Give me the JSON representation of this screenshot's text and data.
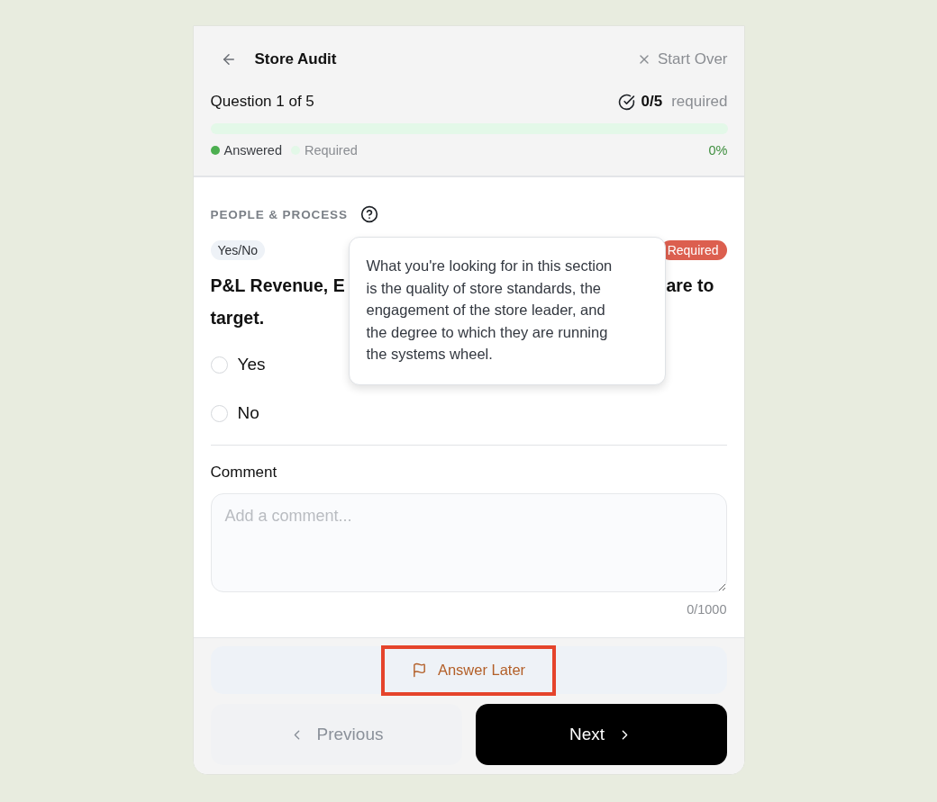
{
  "header": {
    "title": "Store Audit",
    "start_over": "Start Over"
  },
  "progress": {
    "question_label": "Question 1 of 5",
    "count": "0/5",
    "count_label": "required",
    "level": 0,
    "legend": [
      {
        "label": "Answered",
        "color": "#4caf50"
      },
      {
        "label": "Required",
        "color": "#e3f8e8"
      }
    ],
    "percent": "0%"
  },
  "section": {
    "title": "PEOPLE & PROCESS",
    "tooltip": "What you're looking for in this section is the quality of store standards, the engagement of the store leader, and the degree to which they are running the systems wheel."
  },
  "question": {
    "type_badge": "Yes/No",
    "required_badge": "Required",
    "text_fragments": [
      "P&L Revenue, E",
      "are to",
      "target."
    ],
    "options": [
      {
        "label": "Yes",
        "selected": false
      },
      {
        "label": "No",
        "selected": false
      }
    ]
  },
  "comment": {
    "label": "Comment",
    "placeholder": "Add a comment...",
    "counter": "0/1000"
  },
  "footer": {
    "answer_later": {
      "label": "Answer Later",
      "highlighted": true
    },
    "previous": {
      "label": "Previous",
      "disabled": true
    },
    "next": {
      "label": "Next",
      "disabled": false
    }
  }
}
